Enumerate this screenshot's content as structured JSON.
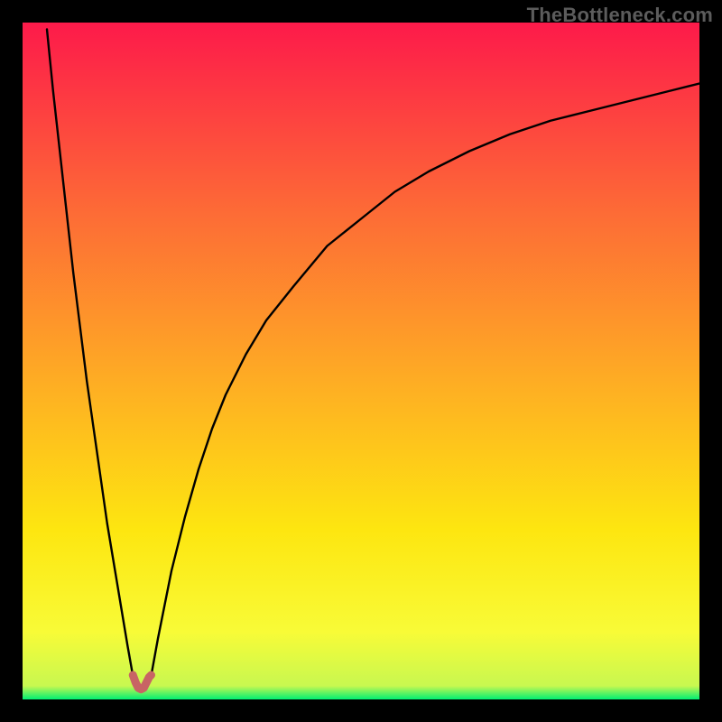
{
  "watermark": "TheBottleneck.com",
  "colors": {
    "frame": "#000000",
    "gradient_top": "#fd1a4a",
    "gradient_upper_mid": "#fd6b36",
    "gradient_mid": "#feb222",
    "gradient_lower_mid": "#fde610",
    "gradient_near_bottom": "#f8fb37",
    "gradient_bottom": "#00ee73",
    "curve_stroke": "#000000",
    "marker_stroke": "#c86464"
  },
  "chart_data": {
    "type": "line",
    "title": "",
    "xlabel": "",
    "ylabel": "",
    "xlim": [
      0,
      100
    ],
    "ylim": [
      0,
      100
    ],
    "x_min_marker": 17.5,
    "curve_left": {
      "comment": "Left branch descending from top-left toward the minimum near x≈16.5",
      "x": [
        3.6,
        4.5,
        5.5,
        6.5,
        7.5,
        8.5,
        9.5,
        10.5,
        11.5,
        12.5,
        13.5,
        14.5,
        15.5,
        16.3
      ],
      "y": [
        99,
        90,
        81,
        72,
        63,
        55,
        47,
        40,
        33,
        26,
        20,
        14,
        8,
        3.5
      ]
    },
    "curve_right": {
      "comment": "Right branch rising from the minimum toward upper-right, saturating around y≈91",
      "x": [
        19,
        20,
        22,
        24,
        26,
        28,
        30,
        33,
        36,
        40,
        45,
        50,
        55,
        60,
        66,
        72,
        78,
        84,
        90,
        96,
        100
      ],
      "y": [
        3.5,
        9,
        19,
        27,
        34,
        40,
        45,
        51,
        56,
        61,
        67,
        71,
        75,
        78,
        81,
        83.5,
        85.5,
        87,
        88.5,
        90,
        91
      ]
    },
    "marker": {
      "comment": "Small salmon-colored U-shaped marker at the curve minimum",
      "x": [
        16.3,
        16.7,
        17.1,
        17.5,
        17.9,
        18.3,
        18.7,
        19.0
      ],
      "y": [
        3.6,
        2.5,
        1.7,
        1.5,
        1.7,
        2.5,
        3.3,
        3.6
      ]
    }
  }
}
